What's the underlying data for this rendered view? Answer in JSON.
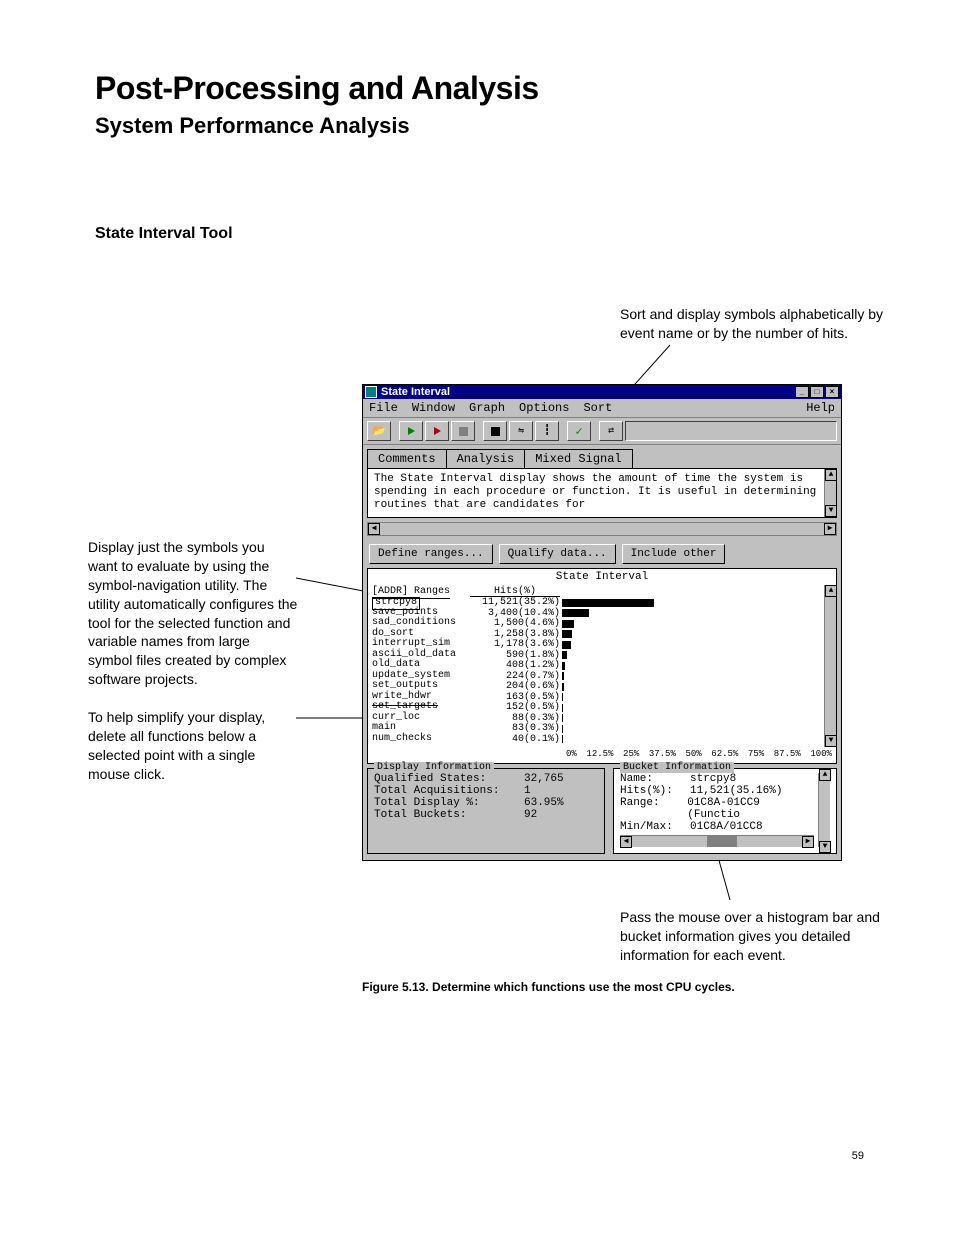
{
  "page_title": "Post-Processing and Analysis",
  "page_subtitle": "System Performance Analysis",
  "section_heading": "State Interval Tool",
  "annotations": {
    "top": "Sort and display symbols alphabetically by event name or by the number of hits.",
    "left1": "Display just the symbols you want to evaluate by using the symbol-navigation utility. The utility automatically configures the tool for the selected function and variable names from large symbol files created by complex software projects.",
    "left2": "To help simplify your display, delete all functions below a selected point with a single mouse click.",
    "bottom": "Pass the mouse over a histogram bar and bucket information gives you detailed information for each event."
  },
  "window": {
    "title": "State Interval",
    "menu": {
      "file": "File",
      "window": "Window",
      "graph": "Graph",
      "options": "Options",
      "sort": "Sort",
      "help": "Help"
    },
    "tabs": {
      "comments": "Comments",
      "analysis": "Analysis",
      "mixed": "Mixed Signal"
    },
    "comment_text": "The State Interval display shows the amount of time the system is spending in each procedure or function.  It is useful in determining routines that are candidates for",
    "buttons": {
      "define_ranges": "Define ranges...",
      "qualify_data": "Qualify data...",
      "include_other": "Include other"
    },
    "chart_title": "State Interval",
    "ranges_header": "[ADDR] Ranges",
    "hits_header": "Hits(%)",
    "display_info_title": "Display Information",
    "bucket_info_title": "Bucket Information",
    "display_info": {
      "qualified_states_l": "Qualified States:",
      "qualified_states_v": "32,765",
      "total_acq_l": "Total Acquisitions:",
      "total_acq_v": "1",
      "total_disp_l": "Total Display %:",
      "total_disp_v": "63.95%",
      "total_buckets_l": "Total Buckets:",
      "total_buckets_v": "92"
    },
    "bucket_info": {
      "name_l": "Name:",
      "name_v": "strcpy8",
      "hits_l": "Hits(%):",
      "hits_v": "11,521(35.16%)",
      "range_l": "Range:",
      "range_v": "01C8A-01CC9 (Functio",
      "minmax_l": "Min/Max:",
      "minmax_v": "01C8A/01CC8"
    }
  },
  "chart_data": {
    "type": "bar",
    "xlabel": "",
    "ylabel": "",
    "xticks": [
      "0%",
      "12.5%",
      "25%",
      "37.5%",
      "50%",
      "62.5%",
      "75%",
      "87.5%",
      "100%"
    ],
    "rows": [
      {
        "name": "strcpy8",
        "hits": 11521,
        "pct": 35.2,
        "label": "11,521(35.2%)"
      },
      {
        "name": "save_points",
        "hits": 3400,
        "pct": 10.4,
        "label": "3,400(10.4%)"
      },
      {
        "name": "sad_conditions",
        "hits": 1500,
        "pct": 4.6,
        "label": "1,500(4.6%)"
      },
      {
        "name": "do_sort",
        "hits": 1258,
        "pct": 3.8,
        "label": "1,258(3.8%)"
      },
      {
        "name": "interrupt_sim",
        "hits": 1178,
        "pct": 3.6,
        "label": "1,178(3.6%)"
      },
      {
        "name": "ascii_old_data",
        "hits": 590,
        "pct": 1.8,
        "label": "590(1.8%)"
      },
      {
        "name": "old_data",
        "hits": 408,
        "pct": 1.2,
        "label": "408(1.2%)"
      },
      {
        "name": "update_system",
        "hits": 224,
        "pct": 0.7,
        "label": "224(0.7%)"
      },
      {
        "name": "set_outputs",
        "hits": 204,
        "pct": 0.6,
        "label": "204(0.6%)"
      },
      {
        "name": "write_hdwr",
        "hits": 163,
        "pct": 0.5,
        "label": "163(0.5%)"
      },
      {
        "name": "set_targets",
        "hits": 152,
        "pct": 0.5,
        "label": "152(0.5%)",
        "crossed": true
      },
      {
        "name": "curr_loc",
        "hits": 88,
        "pct": 0.3,
        "label": "88(0.3%)"
      },
      {
        "name": "main",
        "hits": 83,
        "pct": 0.3,
        "label": "83(0.3%)"
      },
      {
        "name": "num_checks",
        "hits": 40,
        "pct": 0.1,
        "label": "40(0.1%)"
      }
    ]
  },
  "figure_caption": "Figure 5.13. Determine which functions use the most CPU cycles.",
  "page_number": "59"
}
